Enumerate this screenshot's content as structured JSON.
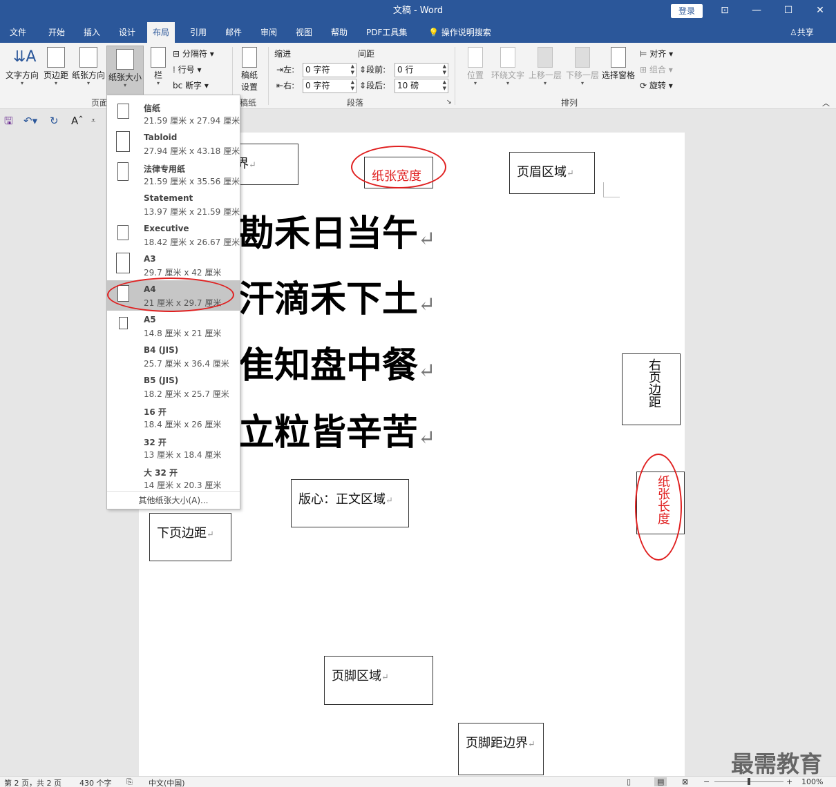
{
  "window": {
    "title": "文稿 - Word",
    "login": "登录"
  },
  "tabs": [
    "文件",
    "开始",
    "插入",
    "设计",
    "布局",
    "引用",
    "邮件",
    "审阅",
    "视图",
    "帮助",
    "PDF工具集",
    "操作说明搜索"
  ],
  "share": "共享",
  "ribbon": {
    "text_direction": "文字方向",
    "margins": "页边距",
    "orientation": "纸张方向",
    "size": "纸张大小",
    "columns": "栏",
    "breaks": "分隔符",
    "line_numbers": "行号",
    "hyphenation": "断字",
    "page_group": "页面",
    "manuscript": "稿纸设置",
    "manuscript_line1": "稿纸",
    "manuscript_line2": "设置",
    "manuscript_group": "稿纸",
    "indent": {
      "title": "缩进",
      "left_label": "左:",
      "left_value": "0 字符",
      "right_label": "右:",
      "right_value": "0 字符"
    },
    "spacing": {
      "title": "间距",
      "before_label": "段前:",
      "before_value": "0 行",
      "after_label": "段后:",
      "after_value": "10 磅"
    },
    "paragraph_group": "段落",
    "position": "位置",
    "wrap_text": "环绕文字",
    "bring_forward": "上移一层",
    "send_backward": "下移一层",
    "selection_pane": "选择窗格",
    "align": "对齐",
    "group": "组合",
    "rotate": "旋转",
    "arrange_group": "排列"
  },
  "paper_sizes": [
    {
      "name": "信纸",
      "size": "21.59 厘米 x 27.94 厘米"
    },
    {
      "name": "Tabloid",
      "size": "27.94 厘米 x 43.18 厘米"
    },
    {
      "name": "法律专用纸",
      "size": "21.59 厘米 x 35.56 厘米"
    },
    {
      "name": "Statement",
      "size": "13.97 厘米 x 21.59 厘米"
    },
    {
      "name": "Executive",
      "size": "18.42 厘米 x 26.67 厘米"
    },
    {
      "name": "A3",
      "size": "29.7 厘米 x 42 厘米"
    },
    {
      "name": "A4",
      "size": "21 厘米 x 29.7 厘米"
    },
    {
      "name": "A5",
      "size": "14.8 厘米 x 21 厘米"
    },
    {
      "name": "B4 (JIS)",
      "size": "25.7 厘米 x 36.4 厘米"
    },
    {
      "name": "B5 (JIS)",
      "size": "18.2 厘米 x 25.7 厘米"
    },
    {
      "name": "16 开",
      "size": "18.4 厘米 x 26 厘米"
    },
    {
      "name": "32 开",
      "size": "13 厘米 x 18.4 厘米"
    },
    {
      "name": "大 32 开",
      "size": "14 厘米 x 20.3 厘米"
    }
  ],
  "selected_paper": "A4",
  "more_paper_sizes": "其他纸张大小(A)...",
  "document": {
    "poem": [
      "锄禾日当午",
      "汗滴禾下土",
      "谁知盘中餐",
      "粒粒皆辛苦"
    ],
    "poem_visible": [
      "勘禾日当午",
      "汗滴禾下土",
      "隹知盘中餐",
      "立粒皆辛苦"
    ],
    "labels": {
      "top_boundary_partial": "界",
      "paper_width": "纸张宽度",
      "header_area": "页眉区域",
      "right_margin": "右页边距",
      "paper_length": "纸张长度",
      "body_area": "版心：正文区域",
      "bottom_margin": "下页边距",
      "footer_area": "页脚区域",
      "footer_boundary": "页脚距边界"
    },
    "paragraph_mark": "↵"
  },
  "status": {
    "page": "第 2 页，共 2 页",
    "words": "430 个字",
    "language": "中文(中国)",
    "zoom": "100%"
  },
  "watermark": "最需教育",
  "colors": {
    "titlebar": "#2b579a",
    "annotation_red": "#e02020"
  }
}
